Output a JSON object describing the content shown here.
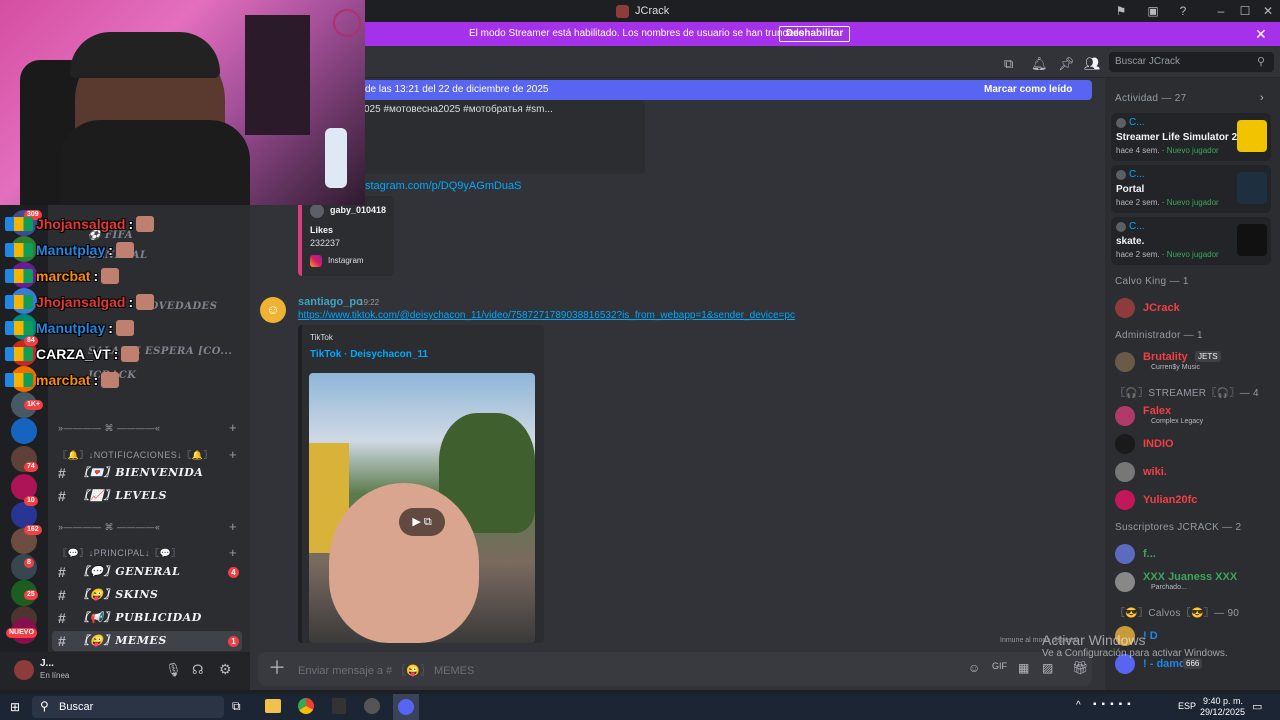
{
  "window": {
    "title": "JCrack"
  },
  "banner": {
    "message": "El modo Streamer está habilitado. Los nombres de usuario se han truncado.",
    "button": "Deshabilitar"
  },
  "header": {
    "search_placeholder": "Buscar JCrack"
  },
  "newbar": {
    "text": "de las 13:21 del 22 de diciembre de 2025",
    "mark_read": "Marcar como leído"
  },
  "messages": {
    "prev_text": "025 #мотовесна2025 #мотобратья #sm...",
    "prev_link": "stagram.com/p/DQ9yAGmDuaS",
    "ig_embed": {
      "user": "gaby_010418",
      "likes_label": "Likes",
      "likes": "232237",
      "source": "Instagram"
    },
    "msg": {
      "author": "santiago_po",
      "time": "19:22",
      "link": "https://www.tiktok.com/@deisychacon_11/video/7587271789038816532?is_from_webapp=1&sender_device=pc",
      "embed_provider": "TikTok",
      "embed_title": "TikTok · Deisychacon_11"
    }
  },
  "composer": {
    "placeholder": "Enviar mensaje a # 〖😜〗 MEMES"
  },
  "sidebar": {
    "categories": [
      {
        "label": "»———— ⌘ ————«"
      },
      {
        "label": "〖🔔〗↓NOTIFICACIONES↓〖🔔〗"
      },
      {
        "label": "»———— ⌘ ————«"
      },
      {
        "label": "〖💬〗↓PRINCIPAL↓〖💬〗"
      }
    ],
    "hidden_channels": [
      "⚽ FIFA",
      "GENERAL",
      "SALA DE ESPERA [CO...",
      "JCRACK",
      "NOVEDADES"
    ],
    "channels": [
      {
        "name": "〖💌〗BIENVENIDA",
        "badge": ""
      },
      {
        "name": "〖📈〗LEVELS",
        "badge": ""
      },
      {
        "name": "〖💬〗GENERAL",
        "badge": "4"
      },
      {
        "name": "〖😜〗SKINS",
        "badge": ""
      },
      {
        "name": "〖📢〗PUBLICIDAD",
        "badge": ""
      },
      {
        "name": "〖😜〗MEMES",
        "badge": "1"
      }
    ],
    "user": {
      "name": "J...",
      "status": "En línea"
    }
  },
  "servers": {
    "badges": [
      "309",
      "84",
      "1K+",
      "74",
      "10",
      "162",
      "8",
      "25",
      "NUEVO"
    ]
  },
  "overlay_chat": [
    {
      "user": "Jhojansalgad",
      "color": "#e53935"
    },
    {
      "user": "Manutplay",
      "color": "#1e88e5"
    },
    {
      "user": "marcbat",
      "color": "#fb8c00"
    },
    {
      "user": "Jhojansalgad",
      "color": "#e53935"
    },
    {
      "user": "Manutplay",
      "color": "#1e88e5"
    },
    {
      "user": "CARZA_VT",
      "color": "#ffffff"
    },
    {
      "user": "marcbat",
      "color": "#fb8c00"
    }
  ],
  "activity": {
    "title": "Actividad — 27",
    "items": [
      {
        "user": "C...",
        "game": "Streamer Life Simulator 2",
        "meta": "hace 4 sem.",
        "tag": "Nuevo jugador"
      },
      {
        "user": "C...",
        "game": "Portal",
        "meta": "hace 2 sem.",
        "tag": "Nuevo jugador"
      },
      {
        "user": "C...",
        "game": "skate.",
        "meta": "hace 2 sem.",
        "tag": "Nuevo jugador"
      }
    ]
  },
  "members": {
    "groups": [
      {
        "title": "Calvo King — 1",
        "members": [
          {
            "name": "JCrack",
            "color": "#f23f43",
            "sub": ""
          }
        ]
      },
      {
        "title": "Administrador — 1",
        "members": [
          {
            "name": "Brutality",
            "color": "#f23f43",
            "sub": "Curren$y Music",
            "tag": "JETS"
          }
        ]
      },
      {
        "title": "〖🎧〗STREAMER〖🎧〗— 4",
        "members": [
          {
            "name": "Falex",
            "color": "#f23f43",
            "sub": "Complex Legacy"
          },
          {
            "name": "INDIO",
            "color": "#f23f43",
            "sub": ""
          },
          {
            "name": "wiki.",
            "color": "#f23f43",
            "sub": ""
          },
          {
            "name": "Yulian20fc",
            "color": "#f23f43",
            "sub": ""
          }
        ]
      },
      {
        "title": "Suscriptores JCRACK — 2",
        "members": [
          {
            "name": "f...",
            "color": "#3ba55c",
            "sub": ""
          },
          {
            "name": "XXX Juaness XXX",
            "color": "#3ba55c",
            "sub": "Parchado..."
          }
        ]
      },
      {
        "title": "〖😎〗Calvos〖😎〗— 90",
        "members": [
          {
            "name": "! D",
            "color": "#1e88e5",
            "sub": ""
          },
          {
            "name": "! - damd",
            "color": "#1e88e5",
            "sub": "",
            "tag": "666"
          }
        ]
      }
    ]
  },
  "watermark": {
    "line1": "Activar Windows",
    "line2": "Ve a Configuración para activar Windows.",
    "immune": "Inmune al modo disperso"
  },
  "taskbar": {
    "search": "Buscar",
    "lang": "ESP",
    "time": "9:40 p. m.",
    "date": "29/12/2025"
  },
  "colors": {
    "blurple": "#5865f2",
    "streamer": "#a532ea",
    "link": "#00a8fc",
    "danger": "#f23f43"
  }
}
